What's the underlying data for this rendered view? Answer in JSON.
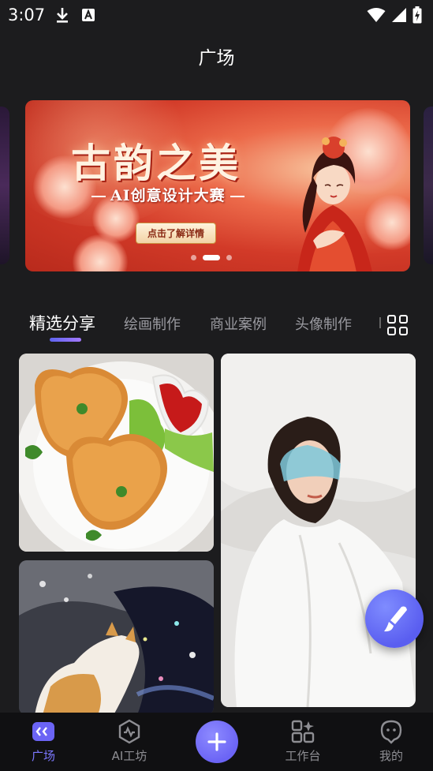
{
  "status_bar": {
    "time": "3:07"
  },
  "header": {
    "title": "广场"
  },
  "banner": {
    "title": "古韵之美",
    "subtitle": "AI创意设计大赛",
    "button_label": "点击了解详情",
    "dot_count": 3,
    "active_dot": 1
  },
  "tabs": [
    {
      "label": "精选分享",
      "active": true
    },
    {
      "label": "绘画制作",
      "active": false
    },
    {
      "label": "商业案例",
      "active": false
    },
    {
      "label": "头像制作",
      "active": false
    }
  ],
  "feed": [
    {
      "subject": "heart-shaped fried cutlets with ketchup"
    },
    {
      "subject": "woman wearing blue sunglasses lying on white sheets"
    },
    {
      "subject": "cat looking at sparkling rainbow water"
    }
  ],
  "bottom_nav": [
    {
      "label": "广场",
      "icon": "plaza-icon",
      "active": true
    },
    {
      "label": "AI工坊",
      "icon": "ai-workshop-icon",
      "active": false
    },
    {
      "label": "工作台",
      "icon": "workbench-icon",
      "active": false
    },
    {
      "label": "我的",
      "icon": "profile-icon",
      "active": false
    }
  ],
  "colors": {
    "accent": "#6b64f5",
    "background": "#1c1c1e",
    "nav_background": "#101012"
  }
}
